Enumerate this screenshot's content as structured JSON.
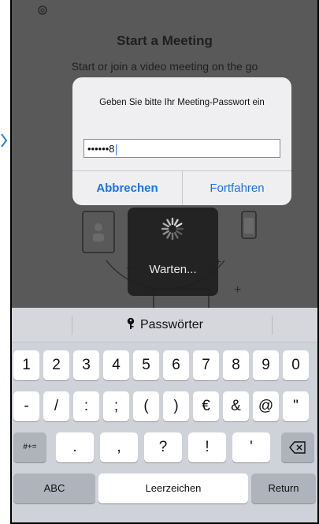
{
  "app": {
    "title": "Start a Meeting",
    "subtitle": "Start or join a video meeting on the go"
  },
  "hud": {
    "label": "Warten..."
  },
  "alert": {
    "message": "Geben Sie bitte Ihr Meeting-Passwort ein",
    "input_value": "••••••8",
    "cancel_label": "Abbrechen",
    "continue_label": "Fortfahren",
    "accent_color": "#1a73e8"
  },
  "keyboard": {
    "passwords_label": "Passwörter",
    "row1": [
      "1",
      "2",
      "3",
      "4",
      "5",
      "6",
      "7",
      "8",
      "9",
      "0"
    ],
    "row2": [
      "-",
      "/",
      ":",
      ";",
      "(",
      ")",
      "€",
      "&",
      "@",
      "\""
    ],
    "row3_left": "#+=",
    "row3": [
      ".",
      ",",
      "?",
      "!",
      "'"
    ],
    "backspace_icon": "delete-left-icon",
    "abc_label": "ABC",
    "space_label": "Leerzeichen",
    "return_label": "Return"
  }
}
